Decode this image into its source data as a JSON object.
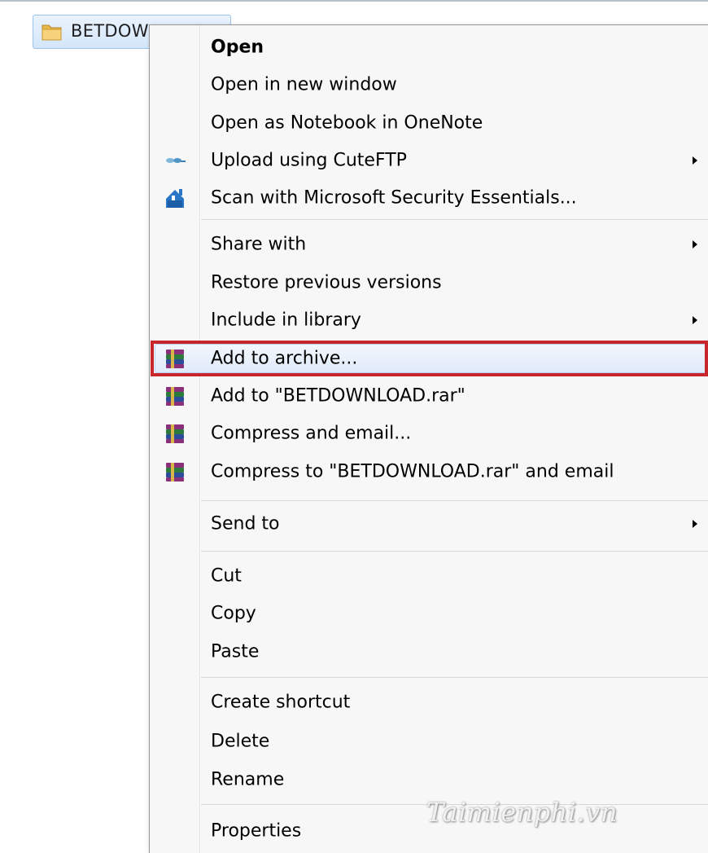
{
  "file": {
    "name": "BETDOWNLOAD",
    "visible_name": "BETDOW",
    "icon": "folder-icon"
  },
  "menu": {
    "items": [
      {
        "label": "Open",
        "bold": true,
        "icon": null,
        "submenu": false
      },
      {
        "label": "Open in new window",
        "icon": null,
        "submenu": false
      },
      {
        "label": "Open as Notebook in OneNote",
        "icon": null,
        "submenu": false
      },
      {
        "label": "Upload using CuteFTP",
        "icon": "cuteftp-icon",
        "submenu": true
      },
      {
        "label": "Scan with Microsoft Security Essentials...",
        "icon": "security-essentials-icon",
        "submenu": false
      },
      {
        "label": "Share with",
        "icon": null,
        "submenu": true
      },
      {
        "label": "Restore previous versions",
        "icon": null,
        "submenu": false
      },
      {
        "label": "Include in library",
        "icon": null,
        "submenu": true
      },
      {
        "label": "Add to archive...",
        "icon": "winrar-icon",
        "submenu": false,
        "highlighted": true
      },
      {
        "label": "Add to \"BETDOWNLOAD.rar\"",
        "icon": "winrar-icon",
        "submenu": false
      },
      {
        "label": "Compress and email...",
        "icon": "winrar-icon",
        "submenu": false
      },
      {
        "label": "Compress to \"BETDOWNLOAD.rar\" and email",
        "icon": "winrar-icon",
        "submenu": false
      },
      {
        "label": "Send to",
        "icon": null,
        "submenu": true
      },
      {
        "label": "Cut",
        "icon": null,
        "submenu": false
      },
      {
        "label": "Copy",
        "icon": null,
        "submenu": false
      },
      {
        "label": "Paste",
        "icon": null,
        "submenu": false
      },
      {
        "label": "Create shortcut",
        "icon": null,
        "submenu": false
      },
      {
        "label": "Delete",
        "icon": null,
        "submenu": false
      },
      {
        "label": "Rename",
        "icon": null,
        "submenu": false
      },
      {
        "label": "Properties",
        "icon": null,
        "submenu": false
      }
    ]
  },
  "colors": {
    "highlight_border": "#c8262c",
    "menu_background": "#f7f7f7"
  },
  "watermark": "Taimienphi.vn"
}
